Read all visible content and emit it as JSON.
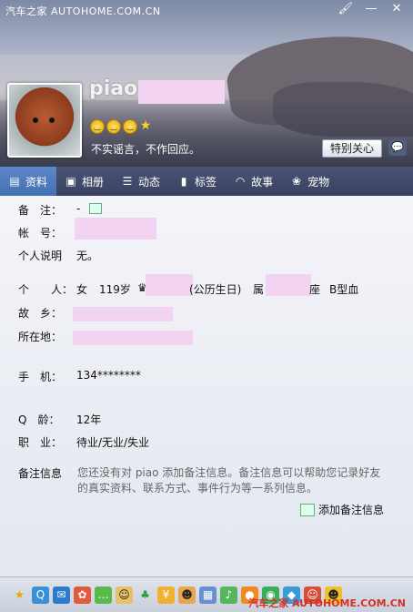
{
  "watermark_top": "汽车之家 AUTOHOME.COM.CN",
  "watermark_bottom": "汽车之家 AUTOHOME.COM.CN",
  "window_controls": [
    "paint-brush-icon",
    "minimize-icon",
    "close-icon"
  ],
  "profile": {
    "nickname": "piao",
    "signature": "不实谣言，不作回应。",
    "care_button": "特别关心",
    "message_button": "message-icon"
  },
  "tabs": [
    {
      "label": "资料",
      "icon": "profile-card-icon"
    },
    {
      "label": "相册",
      "icon": "photo-album-icon"
    },
    {
      "label": "动态",
      "icon": "feed-list-icon"
    },
    {
      "label": "标签",
      "icon": "bookmark-icon"
    },
    {
      "label": "故事",
      "icon": "rainbow-icon"
    },
    {
      "label": "宠物",
      "icon": "pet-icon"
    }
  ],
  "info": {
    "remark_label": "备　注：",
    "remark_value": "-",
    "account_label": "帐　号：",
    "personal_note_label": "个人说明",
    "personal_note_value": "无。",
    "person_label": "个　　人：",
    "gender": "女",
    "age": "119岁",
    "birthday_suffix": "(公历生日)",
    "zodiac_prefix": "属",
    "constellation_suffix": "座",
    "blood_type": "B型血",
    "hometown_label": "故　乡：",
    "location_label": "所在地：",
    "phone_label": "手　机：",
    "phone_value": "134********",
    "qage_label": "Q　龄：",
    "qage_value": "12年",
    "job_label": "职　业：",
    "job_value": "待业/无业/失业",
    "remark_info_label": "备注信息",
    "remark_info_text": "您还没有对 piao 添加备注信息。备注信息可以帮助您记录好友的真实资料、联系方式、事件行为等一系列信息。",
    "add_remark_button": "添加备注信息"
  },
  "accent": "#4271b3"
}
